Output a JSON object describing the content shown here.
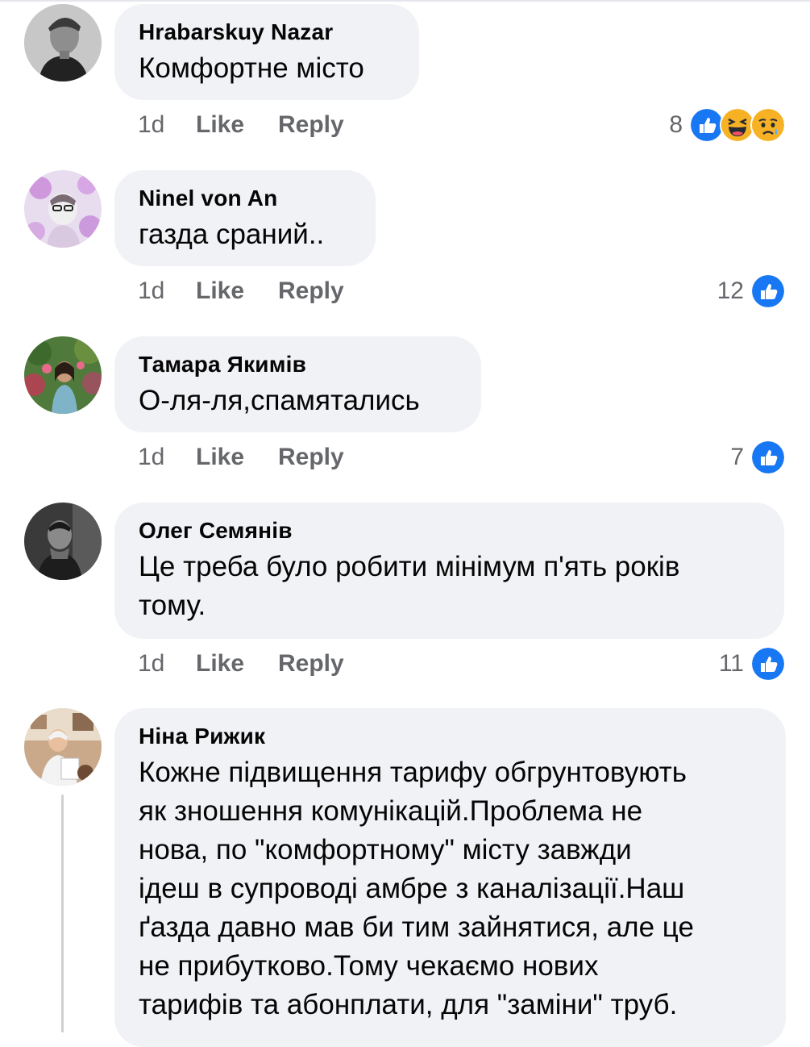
{
  "comments": [
    {
      "author": "Hrabarskuy Nazar",
      "text_lines": [
        "Комфортне місто"
      ],
      "time": "1d",
      "like_label": "Like",
      "reply_label": "Reply",
      "reaction_count": "8",
      "reactions": [
        "like-reaction-icon",
        "haha-reaction-icon",
        "sad-reaction-icon"
      ]
    },
    {
      "author": "Ninel von An",
      "text_lines": [
        "газда сраний.."
      ],
      "time": "1d",
      "like_label": "Like",
      "reply_label": "Reply",
      "reaction_count": "12",
      "reactions": [
        "like-reaction-icon"
      ]
    },
    {
      "author": "Тамара Якимів",
      "text_lines": [
        "О-ля-ля,спамятались"
      ],
      "time": "1d",
      "like_label": "Like",
      "reply_label": "Reply",
      "reaction_count": "7",
      "reactions": [
        "like-reaction-icon"
      ]
    },
    {
      "author": "Олег Семянів",
      "text_lines": [
        "Це треба було робити мінімум п'ять років",
        "тому."
      ],
      "time": "1d",
      "like_label": "Like",
      "reply_label": "Reply",
      "reaction_count": "11",
      "reactions": [
        "like-reaction-icon"
      ]
    },
    {
      "author": "Ніна Рижик",
      "text_lines": [
        "Кожне підвищення тарифу обгрунтовують",
        "як зношення комунікацій.Проблема не",
        "нова, по \"комфортному\" місту завжди",
        "ідеш в супроводі амбре з каналізації.Наш",
        "ґазда давно мав би тим зайнятися, але це",
        "не прибутково.Тому чекаємо нових",
        "тарифів та абонплати, для \"заміни\" труб."
      ]
    }
  ],
  "colors": {
    "bubble": "#f0f2f5",
    "meta": "#65676b",
    "like_blue": "#1877f2",
    "emoji_yellow": "#f7b125"
  }
}
